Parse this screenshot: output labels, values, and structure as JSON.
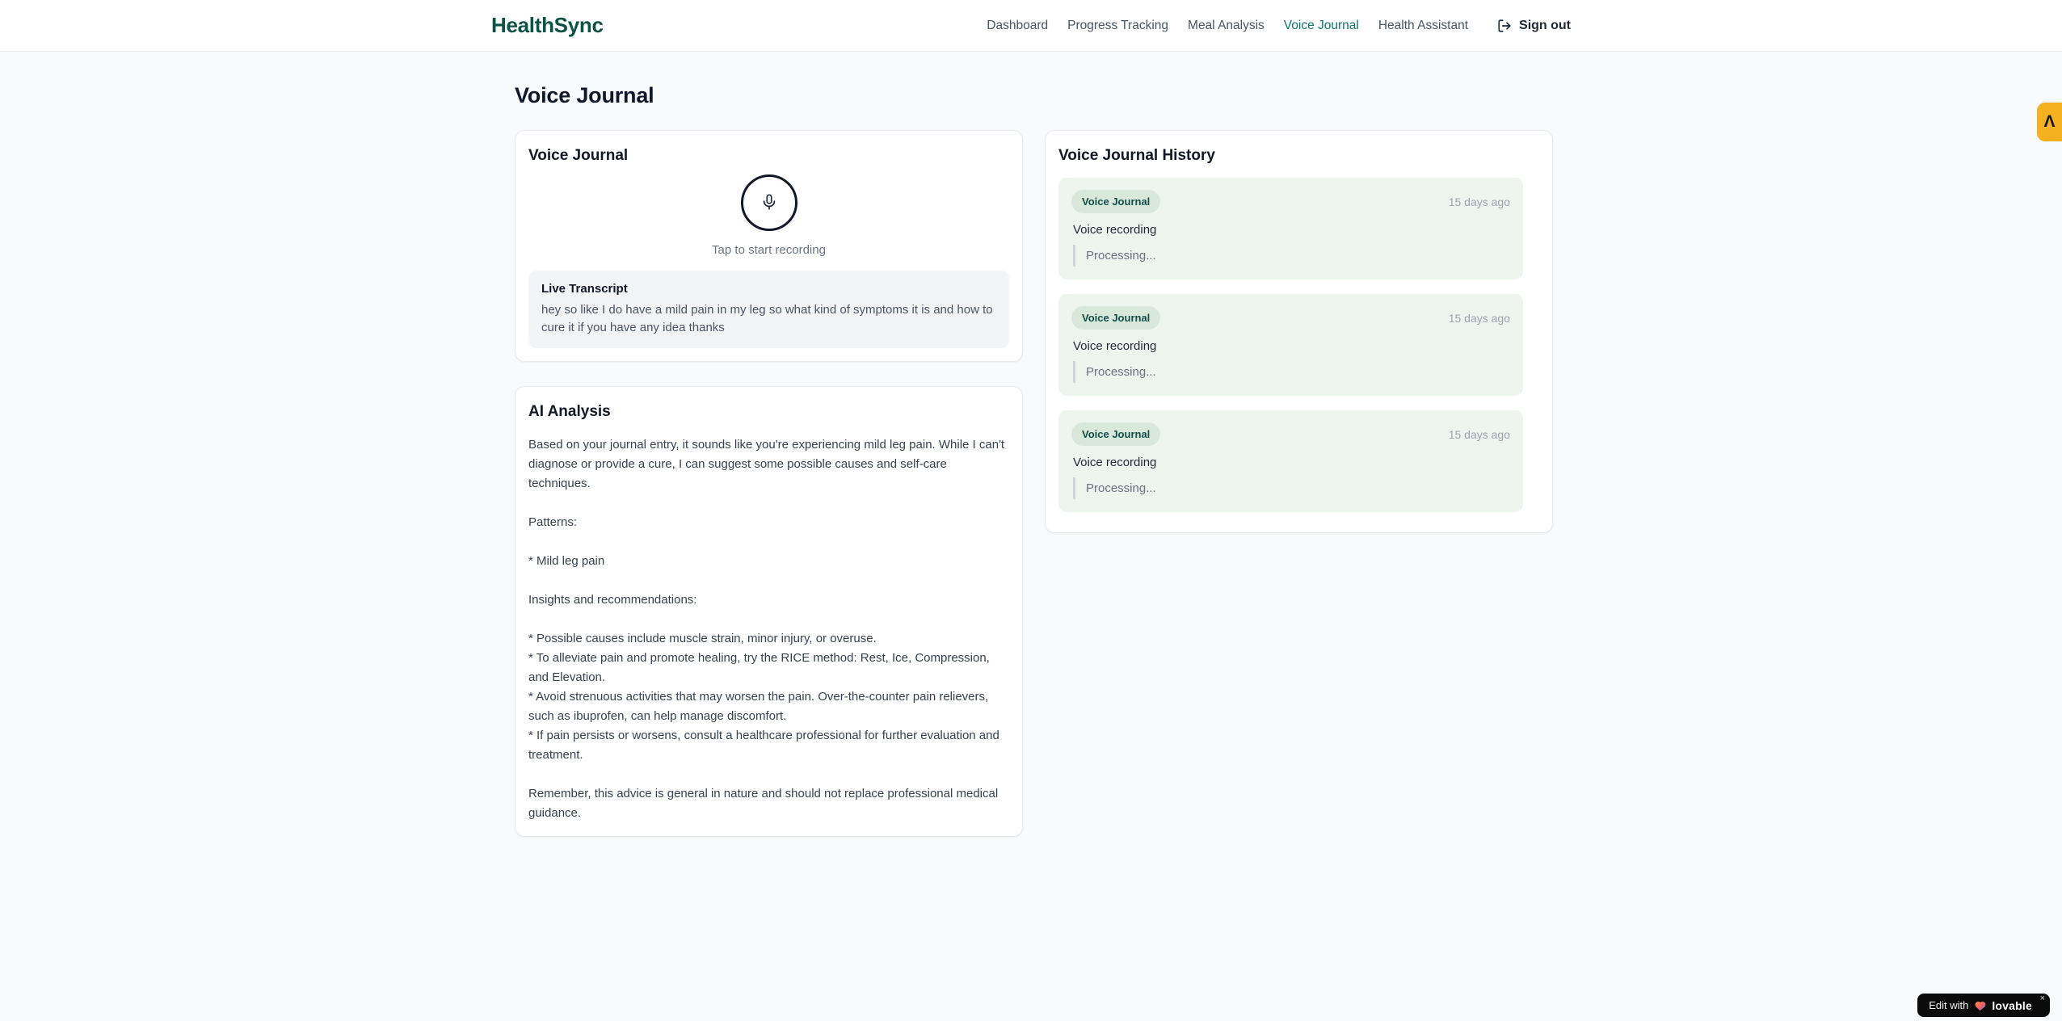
{
  "brand": {
    "name": "HealthSync"
  },
  "nav": {
    "items": [
      {
        "label": "Dashboard",
        "active": false
      },
      {
        "label": "Progress Tracking",
        "active": false
      },
      {
        "label": "Meal Analysis",
        "active": false
      },
      {
        "label": "Voice Journal",
        "active": true
      },
      {
        "label": "Health Assistant",
        "active": false
      }
    ],
    "sign_out_label": "Sign out"
  },
  "page": {
    "title": "Voice Journal"
  },
  "recorder_card": {
    "title": "Voice Journal",
    "tap_hint": "Tap to start recording",
    "transcript_label": "Live Transcript",
    "transcript_text": "hey so like I do have a mild pain in my leg so what kind of symptoms it is and how to cure it if you have any idea thanks"
  },
  "analysis_card": {
    "title": "AI Analysis",
    "paragraphs": [
      "Based on your journal entry, it sounds like you're experiencing mild leg pain. While I can't diagnose or provide a cure, I can suggest some possible causes and self-care techniques.",
      "Patterns:",
      "* Mild leg pain",
      "Insights and recommendations:",
      "* Possible causes include muscle strain, minor injury, or overuse.\n* To alleviate pain and promote healing, try the RICE method: Rest, Ice, Compression, and Elevation.\n* Avoid strenuous activities that may worsen the pain. Over-the-counter pain relievers, such as ibuprofen, can help manage discomfort.\n* If pain persists or worsens, consult a healthcare professional for further evaluation and treatment.",
      "Remember, this advice is general in nature and should not replace professional medical guidance."
    ]
  },
  "history_card": {
    "title": "Voice Journal History",
    "entries": [
      {
        "badge": "Voice Journal",
        "time": "15 days ago",
        "label": "Voice recording",
        "status": "Processing..."
      },
      {
        "badge": "Voice Journal",
        "time": "15 days ago",
        "label": "Voice recording",
        "status": "Processing..."
      },
      {
        "badge": "Voice Journal",
        "time": "15 days ago",
        "label": "Voice recording",
        "status": "Processing..."
      }
    ]
  },
  "widgets": {
    "edit_badge": {
      "prefix": "Edit with",
      "brand": "lovable",
      "close": "×"
    },
    "side_badge": {
      "icon": "accessibility-widget",
      "glyph": "Λ"
    }
  },
  "colors": {
    "brand_teal": "#0d5246",
    "active_nav": "#0f766e",
    "page_bg": "#f8fafc",
    "entry_bg": "#edf5ee",
    "badge_bg": "#d8e8db",
    "badge_text": "#134e48",
    "accent_orange": "#f5b120",
    "mic_border": "#10192a"
  }
}
